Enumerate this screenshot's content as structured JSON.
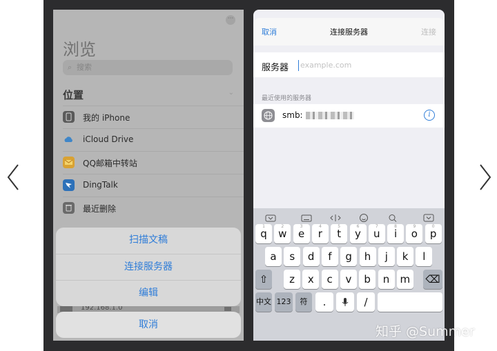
{
  "left_panel": {
    "title": "浏览",
    "search_placeholder": "搜索",
    "section": "位置",
    "locations": [
      {
        "label": "我的 iPhone",
        "icon": "iphone-icon"
      },
      {
        "label": "iCloud Drive",
        "icon": "icloud-icon"
      },
      {
        "label": "QQ邮箱中转站",
        "icon": "qq-mail-icon"
      },
      {
        "label": "DingTalk",
        "icon": "dingtalk-icon"
      },
      {
        "label": "最近删除",
        "icon": "trash-icon"
      }
    ],
    "action_sheet": {
      "items": [
        "扫描文稿",
        "连接服务器",
        "编辑"
      ],
      "peek_text": "192.168.1.0",
      "cancel": "取消"
    }
  },
  "right_panel": {
    "header": {
      "cancel": "取消",
      "title": "连接服务器",
      "connect": "连接"
    },
    "server_label": "服务器",
    "server_placeholder": "example.com",
    "recent_header": "最近使用的服务器",
    "recent_server_prefix": "smb:"
  },
  "keyboard": {
    "row1": [
      "q",
      "w",
      "e",
      "r",
      "t",
      "y",
      "u",
      "i",
      "o",
      "p"
    ],
    "row1_hints": [
      "1",
      "2",
      "3",
      "4",
      "5",
      "6",
      "7",
      "8",
      "9",
      "0"
    ],
    "row2": [
      "a",
      "s",
      "d",
      "f",
      "g",
      "h",
      "j",
      "k",
      "l"
    ],
    "row3": [
      "z",
      "x",
      "c",
      "v",
      "b",
      "n",
      "m"
    ],
    "row4": [
      "中文",
      "123",
      "符",
      ".",
      "/"
    ]
  },
  "watermark": "知乎 @Summer",
  "colors": {
    "accent": "#2f7dd8",
    "panel_dim": "#b6b6b6",
    "frame": "#2c2c2e"
  }
}
